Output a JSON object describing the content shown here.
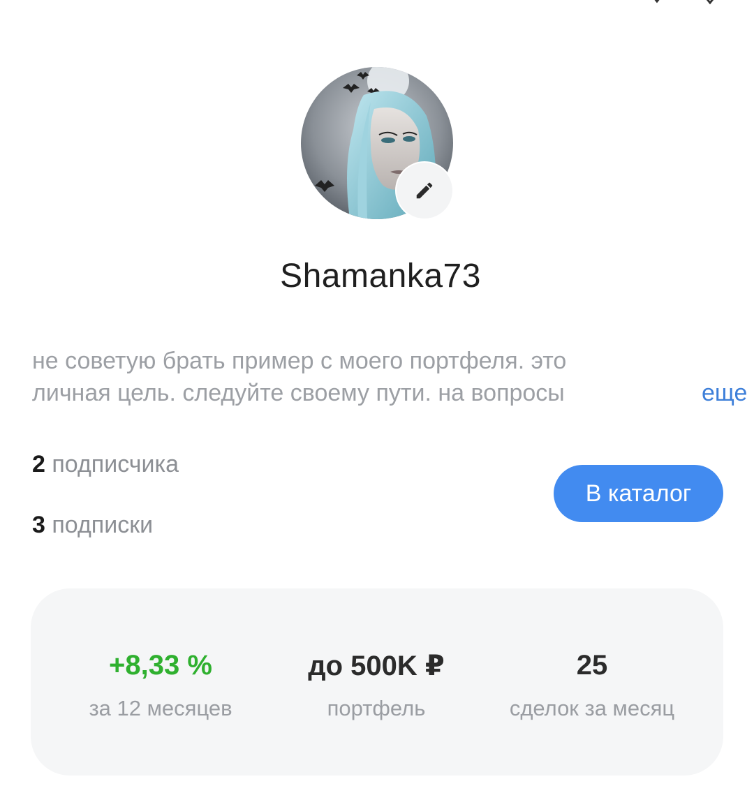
{
  "profile": {
    "username": "Shamanka73",
    "avatar_alt": "",
    "edit_icon": "pencil-icon"
  },
  "bio": {
    "line1": "не советую брать пример с моего портфеля. это",
    "line2": "личная цель. следуйте своему пути. на вопросы",
    "more_label": "еще"
  },
  "followers": {
    "count": "2",
    "label": "подписчика"
  },
  "following": {
    "count": "3",
    "label": "подписки"
  },
  "catalog_button": {
    "label": "В каталог"
  },
  "stats": [
    {
      "value": "+8,33 %",
      "caption": "за 12 месяцев",
      "tone": "positive"
    },
    {
      "value": "до 500K ₽",
      "caption": "портфель",
      "tone": "neutral"
    },
    {
      "value": "25",
      "caption": "сделок за месяц",
      "tone": "neutral"
    }
  ],
  "colors": {
    "accent": "#428bf0",
    "link": "#3d7fd9",
    "positive": "#2fb02f",
    "card_bg": "#f5f6f7",
    "muted_text": "#9c9fa4"
  }
}
